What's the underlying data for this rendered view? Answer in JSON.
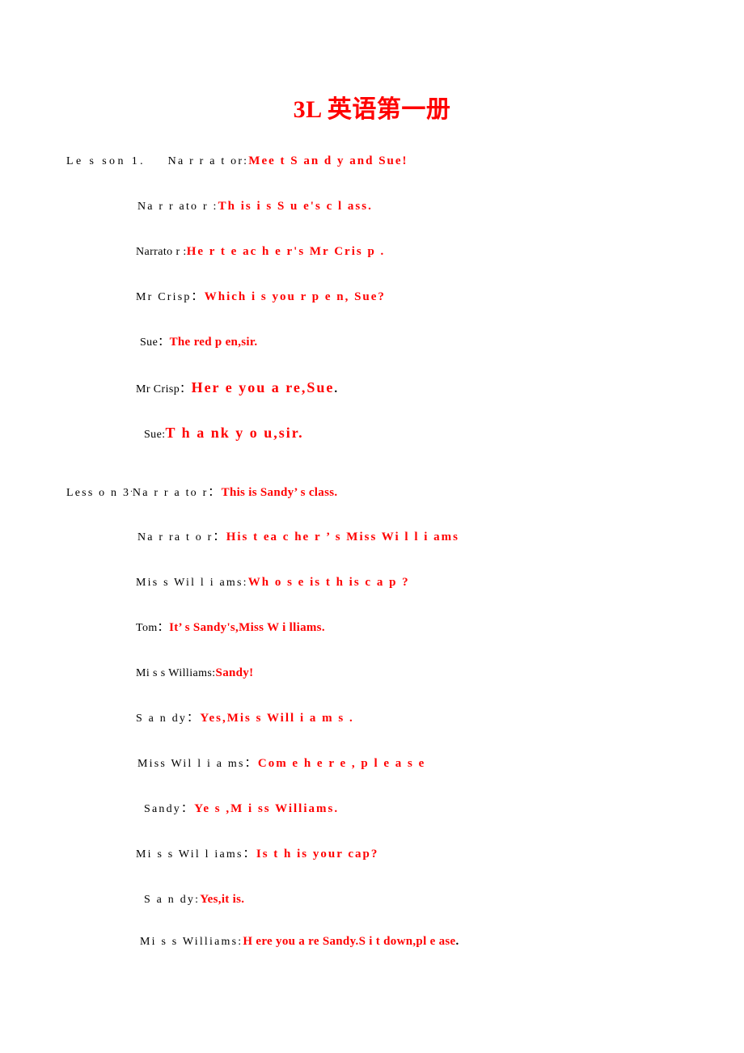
{
  "document": {
    "title": "3L 英语第一册",
    "title_color": "#FF0000",
    "text_color": "#000000",
    "dialogue_color": "#FF0000",
    "background": "#ffffff"
  },
  "lessons": [
    {
      "id": "lesson-1",
      "label": "Le s son  1.",
      "lines": [
        {
          "speaker": "Na r r a t or:",
          "text": "Mee t    S an d y  and Sue!"
        },
        {
          "speaker": "Na r r ato r :",
          "text": "Th is i s  S u e's c l ass."
        },
        {
          "speaker": "Narrato r :",
          "text": "He r  t e ac h e r's Mr   Cris p ."
        },
        {
          "speaker": "Mr  Crisp：",
          "text": "Which i s  you r  p e n, Sue?"
        },
        {
          "speaker": "Sue：",
          "text": "The red  p en,sir."
        },
        {
          "speaker": "Mr  Crisp：",
          "text": "Her e  you  a re,Sue",
          "trailing": "."
        },
        {
          "speaker": "Sue:",
          "text": "T h a nk y o u,sir."
        }
      ]
    },
    {
      "id": "lesson-3",
      "label": "Less o n  3",
      "separator": "∙",
      "lines": [
        {
          "speaker": "Na r r a to r：",
          "text": "This is Sandy’  s  class."
        },
        {
          "speaker": "Na r ra t o r：",
          "text": "His  t ea c he r ’ s  Miss  Wi l l i ams"
        },
        {
          "speaker": "Mis s   Wil l i ams:",
          "text": "Wh o s e is  t h is  c a p ?"
        },
        {
          "speaker": "Tom：",
          "text": "It’  s  Sandy's,Miss   W i lliams."
        },
        {
          "speaker": "Mi s s Williams:",
          "text": "Sandy!"
        },
        {
          "speaker": "S a n dy：",
          "text": "Yes,Mis s   Will i a m s ."
        },
        {
          "speaker": "Miss   Wil l i a ms：",
          "text": "Com e   h e r e , p l e a s e"
        },
        {
          "speaker": "Sandy：",
          "text": "Ye s ,M i ss   Williams."
        },
        {
          "speaker": "Mi s s Wil l iams：",
          "text": "Is  t h is your   cap?"
        },
        {
          "speaker": "S a n dy:",
          "text": "Yes,it is."
        },
        {
          "speaker": "Mi s s  Williams:",
          "text": "H ere you  a re Sandy.S i t down,pl e ase",
          "trailing": "."
        }
      ]
    }
  ]
}
